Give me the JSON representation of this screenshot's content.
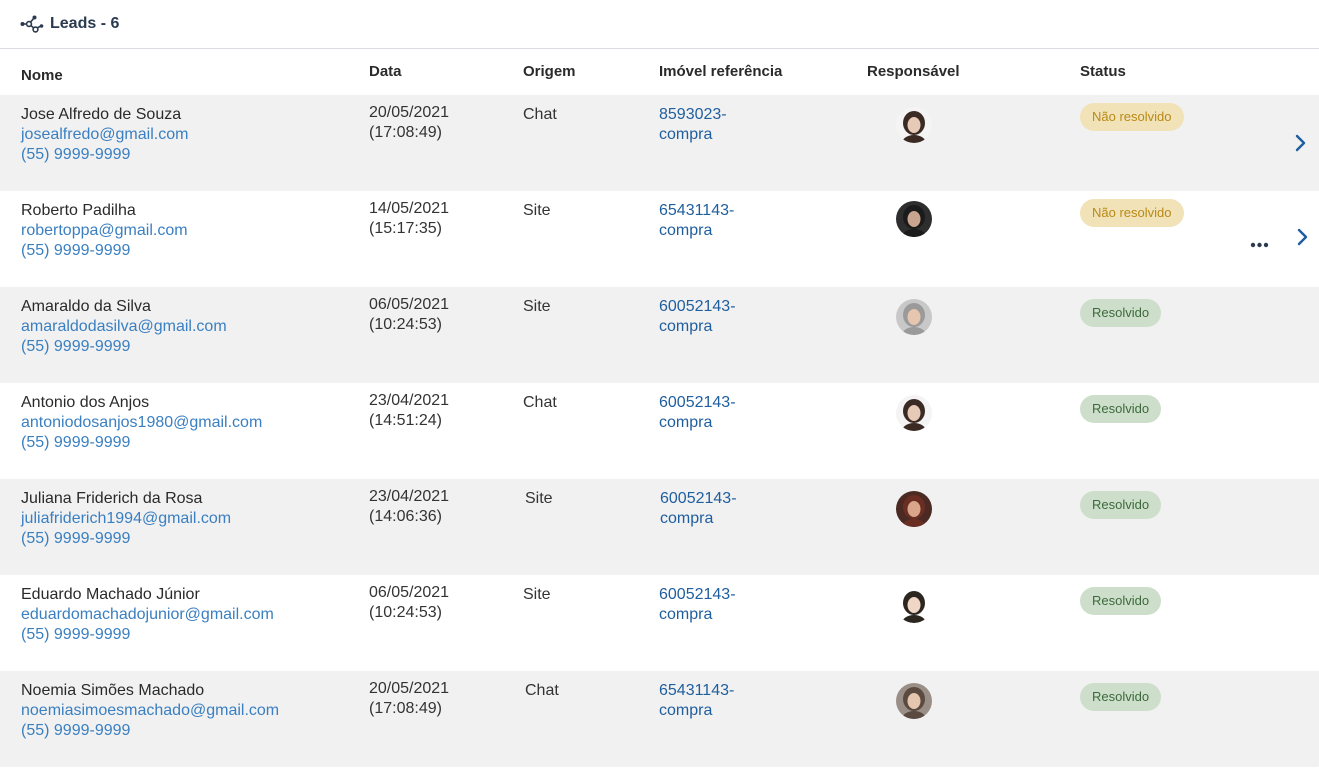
{
  "header": {
    "title": "Leads - 6",
    "icon": "network-nodes-icon"
  },
  "columns": {
    "nome": "Nome",
    "data": "Data",
    "origem": "Origem",
    "imovel": "Imóvel referência",
    "responsavel": "Responsável",
    "status": "Status"
  },
  "colors": {
    "pending_bg": "#f1e2b8",
    "pending_text": "#b98a17",
    "done_bg": "#cddfca",
    "done_text": "#3c6a3c",
    "link": "#3a7fc1"
  },
  "rows": [
    {
      "name": "Jose Alfredo de Souza",
      "email": "josealfredo@gmail.com",
      "phone": "(55) 9999-9999",
      "date": "20/05/2021",
      "time": "(17:08:49)",
      "origin": "Chat",
      "ref1": "8593023-",
      "ref2": "compra",
      "status": "Não resolvido",
      "status_kind": "pending"
    },
    {
      "name": "Roberto Padilha",
      "email": "robertoppa@gmail.com",
      "phone": "(55) 9999-9999",
      "date": "14/05/2021",
      "time": "(15:17:35)",
      "origin": "Site",
      "ref1": "65431143-",
      "ref2": "compra",
      "status": "Não resolvido",
      "status_kind": "pending"
    },
    {
      "name": "Amaraldo da Silva",
      "email": "amaraldodasilva@gmail.com",
      "phone": "(55) 9999-9999",
      "date": "06/05/2021",
      "time": "(10:24:53)",
      "origin": "Site",
      "ref1": "60052143-",
      "ref2": "compra",
      "status": "Resolvido",
      "status_kind": "done"
    },
    {
      "name": "Antonio dos Anjos",
      "email": "antoniodosanjos1980@gmail.com",
      "phone": "(55) 9999-9999",
      "date": "23/04/2021",
      "time": "(14:51:24)",
      "origin": "Chat",
      "ref1": "60052143-",
      "ref2": "compra",
      "status": "Resolvido",
      "status_kind": "done"
    },
    {
      "name": "Juliana Friderich da Rosa",
      "email": "juliafriderich1994@gmail.com",
      "phone": "(55) 9999-9999",
      "date": "23/04/2021",
      "time": "(14:06:36)",
      "origin": "Site",
      "ref1": "60052143-",
      "ref2": "compra",
      "status": "Resolvido",
      "status_kind": "done"
    },
    {
      "name": "Eduardo Machado Júnior",
      "email": "eduardomachadojunior@gmail.com",
      "phone": "(55) 9999-9999",
      "date": "06/05/2021",
      "time": "(10:24:53)",
      "origin": "Site",
      "ref1": "60052143-",
      "ref2": "compra",
      "status": "Resolvido",
      "status_kind": "done"
    },
    {
      "name": "Noemia Simões Machado",
      "email": "noemiasimoesmachado@gmail.com",
      "phone": "(55) 9999-9999",
      "date": "20/05/2021",
      "time": "(17:08:49)",
      "origin": "Chat",
      "ref1": "65431143-",
      "ref2": "compra",
      "status": "Resolvido",
      "status_kind": "done"
    }
  ]
}
